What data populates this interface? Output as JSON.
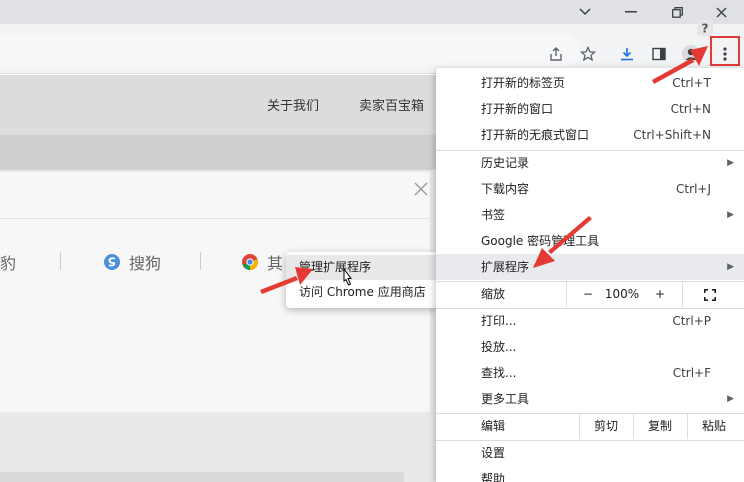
{
  "window": {
    "minimize_icon": "chevron-down-icon",
    "close_icon": "close-icon"
  },
  "page": {
    "nav": [
      "关于我们",
      "卖家百宝箱"
    ],
    "engines": [
      "猎豹",
      "搜狗",
      "其"
    ]
  },
  "submenu": {
    "items": [
      "管理扩展程序",
      "访问 Chrome 应用商店"
    ]
  },
  "menu": {
    "new_tab": {
      "label": "打开新的标签页",
      "shortcut": "Ctrl+T"
    },
    "new_window": {
      "label": "打开新的窗口",
      "shortcut": "Ctrl+N"
    },
    "incognito": {
      "label": "打开新的无痕式窗口",
      "shortcut": "Ctrl+Shift+N"
    },
    "history": {
      "label": "历史记录"
    },
    "downloads": {
      "label": "下载内容",
      "shortcut": "Ctrl+J"
    },
    "bookmarks": {
      "label": "书签"
    },
    "passwords": {
      "label": "Google 密码管理工具"
    },
    "extensions": {
      "label": "扩展程序"
    },
    "zoom": {
      "label": "缩放",
      "minus": "−",
      "value": "100%",
      "plus": "+"
    },
    "print": {
      "label": "打印...",
      "shortcut": "Ctrl+P"
    },
    "cast": {
      "label": "投放..."
    },
    "find": {
      "label": "查找...",
      "shortcut": "Ctrl+F"
    },
    "more_tools": {
      "label": "更多工具"
    },
    "edit": {
      "label": "编辑",
      "cut": "剪切",
      "copy": "复制",
      "paste": "粘贴"
    },
    "settings": {
      "label": "设置"
    },
    "help": {
      "label": "帮助"
    }
  },
  "colors": {
    "annotation": "#e53935",
    "menu_highlight": "#e8eaed"
  }
}
